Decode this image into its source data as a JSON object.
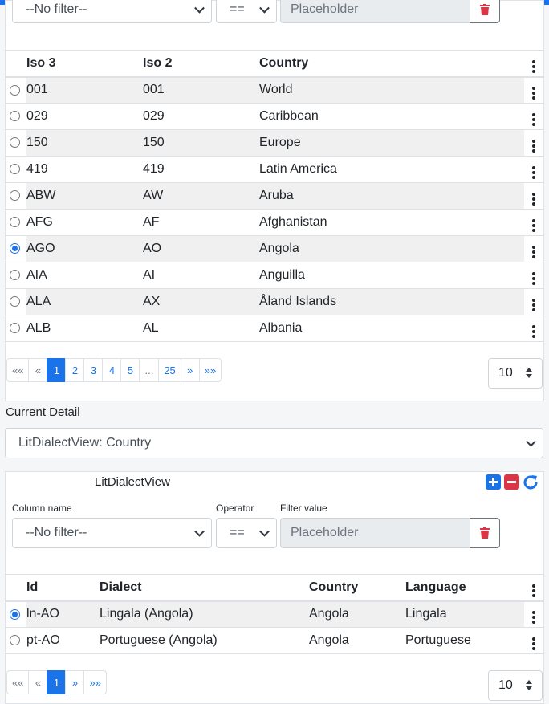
{
  "filter1": {
    "column_value": "--No filter--",
    "operator_value": "==",
    "filter_placeholder": "Placeholder"
  },
  "countries_table": {
    "columns": [
      "Iso 3",
      "Iso 2",
      "Country"
    ],
    "rows": [
      {
        "iso3": "001",
        "iso2": "001",
        "country": "World",
        "selected": false
      },
      {
        "iso3": "029",
        "iso2": "029",
        "country": "Caribbean",
        "selected": false
      },
      {
        "iso3": "150",
        "iso2": "150",
        "country": "Europe",
        "selected": false
      },
      {
        "iso3": "419",
        "iso2": "419",
        "country": "Latin America",
        "selected": false
      },
      {
        "iso3": "ABW",
        "iso2": "AW",
        "country": "Aruba",
        "selected": false
      },
      {
        "iso3": "AFG",
        "iso2": "AF",
        "country": "Afghanistan",
        "selected": false
      },
      {
        "iso3": "AGO",
        "iso2": "AO",
        "country": "Angola",
        "selected": true
      },
      {
        "iso3": "AIA",
        "iso2": "AI",
        "country": "Anguilla",
        "selected": false
      },
      {
        "iso3": "ALA",
        "iso2": "AX",
        "country": "Åland Islands",
        "selected": false
      },
      {
        "iso3": "ALB",
        "iso2": "AL",
        "country": "Albania",
        "selected": false
      }
    ]
  },
  "pager1": {
    "first": "««",
    "prev": "«",
    "pages": [
      "1",
      "2",
      "3",
      "4",
      "5"
    ],
    "active_page": "1",
    "ellipsis": "...",
    "last_page": "25",
    "next": "»",
    "last": "»»",
    "page_size": "10"
  },
  "current_detail": {
    "label": "Current Detail",
    "selected": "LitDialectView: Country"
  },
  "dialect_panel": {
    "title": "LitDialectView",
    "column_label": "Column name",
    "operator_label": "Operator",
    "filter_label": "Filter value",
    "column_value": "--No filter--",
    "operator_value": "==",
    "filter_placeholder": "Placeholder",
    "add_icon": "plus-square-icon",
    "remove_icon": "minus-square-icon",
    "refresh_icon": "refresh-icon",
    "accent_color": "#1a73e8",
    "danger_color": "#dc3545"
  },
  "dialect_table": {
    "columns": [
      "Id",
      "Dialect",
      "Country",
      "Language"
    ],
    "rows": [
      {
        "id": "ln-AO",
        "dialect": "Lingala (Angola)",
        "country": "Angola",
        "language": "Lingala",
        "selected": true
      },
      {
        "id": "pt-AO",
        "dialect": "Portuguese (Angola)",
        "country": "Angola",
        "language": "Portuguese",
        "selected": false
      }
    ]
  },
  "pager2": {
    "first": "««",
    "prev": "«",
    "active_page": "1",
    "next": "»",
    "last": "»»",
    "page_size": "10"
  }
}
